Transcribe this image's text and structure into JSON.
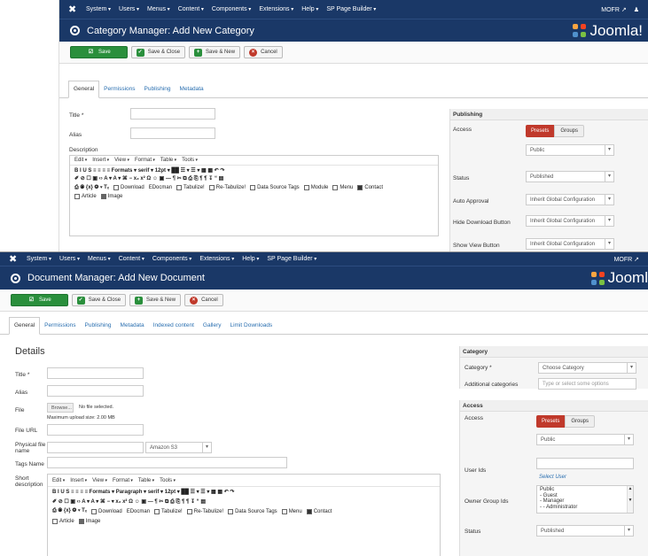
{
  "shot1": {
    "nav": {
      "items": [
        "System",
        "Users",
        "Menus",
        "Content",
        "Components",
        "Extensions",
        "Help",
        "SP Page Builder"
      ],
      "user": "MOFR",
      "user_icon": "↗",
      "person_icon": "♟"
    },
    "title": "Category Manager: Add New Category",
    "brand": "Joomla!",
    "toolbar": {
      "save": "Save",
      "save_close": "Save & Close",
      "save_new": "Save & New",
      "cancel": "Cancel"
    },
    "tabs": [
      "General",
      "Permissions",
      "Publishing",
      "Metadata"
    ],
    "form": {
      "title_label": "Title *",
      "alias_label": "Alias",
      "description_label": "Description"
    },
    "editor": {
      "menubar": [
        "Edit",
        "Insert",
        "View",
        "Format",
        "Table",
        "Tools"
      ],
      "row1": "B  I  U  S   ≡  ≡  ≡  ≡   Formats ▾   serif   ▾  12pt   ▾   ██  ☰ ▾  ☰ ▾  ▦  ▦   ↶  ↷",
      "row2": "✐  ⊘  ☐  ▣   ‹›   A ▾  A ▾   ⌘   −   x₂  x²   Ω  ☺  ▣   —  ¶   ✂  ⧉  ⎙  ⎘   ¶  ¶   ↧  “  ▤",
      "row3_prefix": "⎙  ◉  {x}  ❂ ▾  Tₓ",
      "row3_items": [
        "Download",
        "EDocman",
        "Tabulize!",
        "Re-Tabulize!",
        "Data Source Tags",
        "Module",
        "Menu",
        "Contact"
      ],
      "row4_items": [
        "Article",
        "Image"
      ]
    },
    "publishing": {
      "heading": "Publishing",
      "access_label": "Access",
      "presets": "Presets",
      "groups": "Groups",
      "access_value": "Public",
      "status_label": "Status",
      "status_value": "Published",
      "auto_approval_label": "Auto Approval",
      "auto_approval_value": "Inherit Global Configuration",
      "hide_download_label": "Hide Download Button",
      "hide_download_value": "Inherit Global Configuration",
      "show_view_label": "Show View Button",
      "show_view_value": "Inherit Global Configuration"
    }
  },
  "shot2": {
    "nav": {
      "items": [
        "System",
        "Users",
        "Menus",
        "Content",
        "Components",
        "Extensions",
        "Help",
        "SP Page Builder"
      ],
      "user": "MOFR",
      "user_icon": "↗"
    },
    "title": "Document Manager: Add New Document",
    "brand": "Jooml",
    "toolbar": {
      "save": "Save",
      "save_close": "Save & Close",
      "save_new": "Save & New",
      "cancel": "Cancel"
    },
    "tabs": [
      "General",
      "Permissions",
      "Publishing",
      "Metadata",
      "Indexed content",
      "Gallery",
      "Limit Downloads"
    ],
    "details": {
      "heading": "Details",
      "title_label": "Title *",
      "alias_label": "Alias",
      "file_label": "File",
      "browse": "Browse...",
      "no_file": "No file selected.",
      "max_upload": "Maximum upload size: 2.00 MB",
      "file_url_label": "File URL",
      "physical_label": "Physical file name",
      "physical_select": "Amazon S3",
      "tags_label": "Tags Name",
      "short_desc_label": "Short description"
    },
    "editor": {
      "menubar": [
        "Edit",
        "Insert",
        "View",
        "Format",
        "Table",
        "Tools"
      ],
      "row1": "B  I  U  S   ≡  ≡  ≡  ≡   Formats ▾  Paragraph  ▾   serif   ▾    12pt    ▾   ██  ☰ ▾  ☰ ▾  ▦  ▦   ↶  ↷",
      "row2": "✐  ⊘  ☐  ▣   ‹›   A ▾  A ▾   ⌘   − ▾  x₂  x²   Ω  ☺  ▣   —  ¶   ✂  ⧉  ⎙  ⎘   ¶  ¶   ↧  “  ▤",
      "row3_prefix": "⎙  ◉  {x}  ❂ ▾  Tₓ",
      "row3_items": [
        "Download",
        "EDocman",
        "Tabulize!",
        "Re-Tabulize!",
        "Data Source Tags",
        "Menu",
        "Contact"
      ],
      "row4_items": [
        "Article",
        "Image"
      ]
    },
    "category_panel": {
      "heading": "Category",
      "category_label": "Category *",
      "category_value": "Choose Category",
      "additional_label": "Additional categories",
      "additional_placeholder": "Type or select some options"
    },
    "access_panel": {
      "heading": "Access",
      "access_label": "Access",
      "presets": "Presets",
      "groups": "Groups",
      "access_value": "Public",
      "user_ids_label": "User Ids",
      "select_user": "Select User",
      "owner_group_label": "Owner Group Ids",
      "owner_groups": [
        "Public",
        "- Guest",
        "- Manager",
        "- - Administrator"
      ],
      "status_label": "Status",
      "status_value": "Published"
    }
  }
}
